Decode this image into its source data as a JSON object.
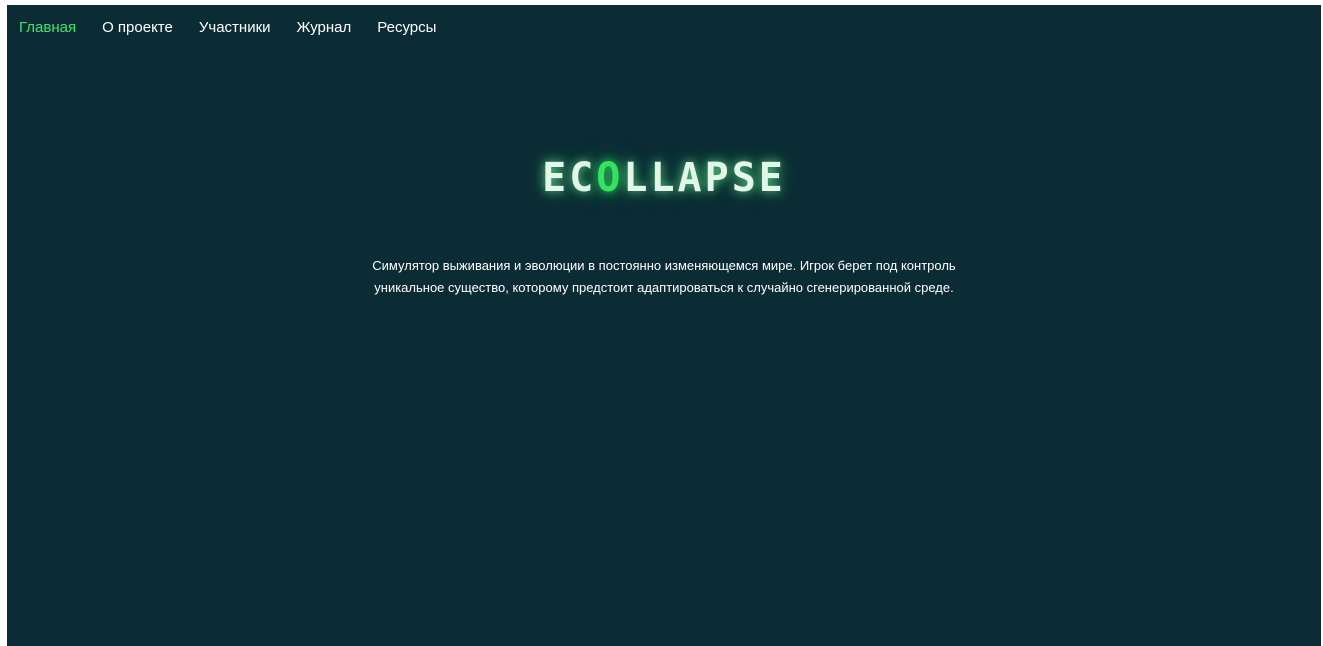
{
  "nav": {
    "items": [
      {
        "label": "Главная",
        "active": true
      },
      {
        "label": "О проекте",
        "active": false
      },
      {
        "label": "Участники",
        "active": false
      },
      {
        "label": "Журнал",
        "active": false
      },
      {
        "label": "Ресурсы",
        "active": false
      }
    ]
  },
  "hero": {
    "logo_prefix": "EC",
    "logo_accent": "O",
    "logo_suffix": "LLAPSE",
    "description_line1": "Симулятор выживания и эволюции в постоянно изменяющемся мире. Игрок берет под контроль",
    "description_line2": "уникальное существо, которому предстоит адаптироваться к случайно сгенерированной среде."
  },
  "colors": {
    "background": "#0b2c34",
    "accent": "#39e86b",
    "text": "#ffffff"
  }
}
